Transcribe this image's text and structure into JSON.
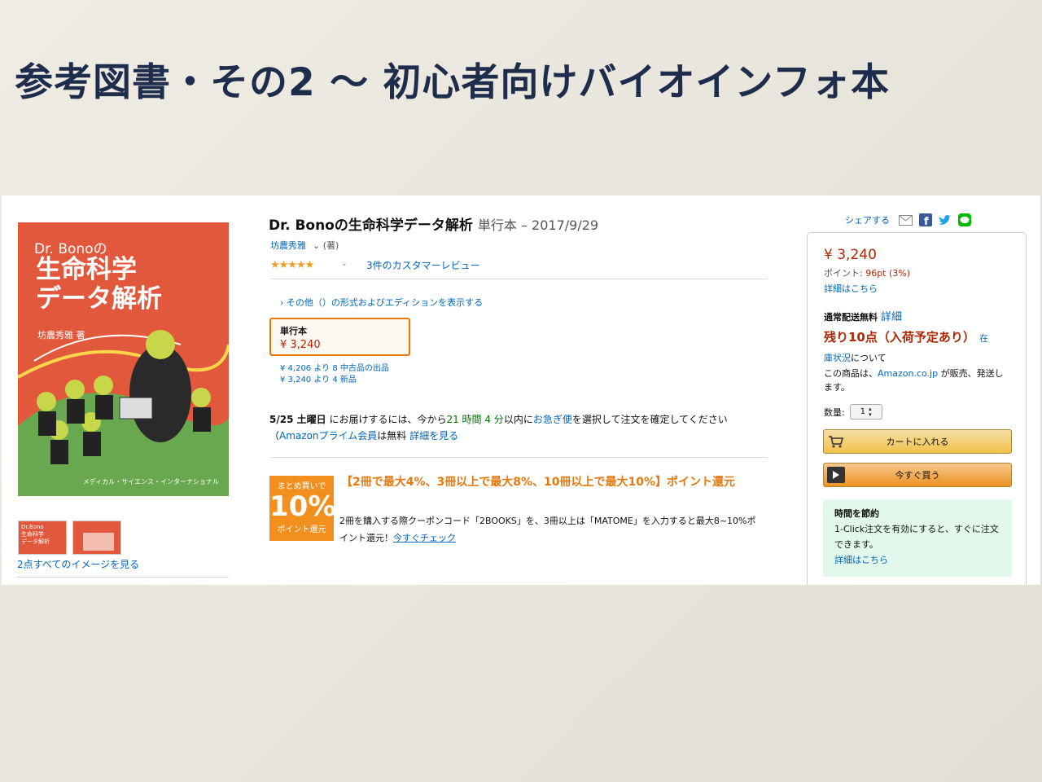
{
  "slide": {
    "title": "参考図書・その2 〜 初心者向けバイオインフォ本"
  },
  "cover": {
    "brand": "Dr. Bonoの",
    "title": "生命科学\nデータ解析",
    "author": "坊農秀雅 著",
    "publisher": "メディカル・サイエンス・インターナショナル",
    "bg_color": "#e2583c"
  },
  "thumbnails": [
    {
      "text": "Dr.Bono\n生命科学\nデータ解析"
    },
    {
      "text": ""
    }
  ],
  "images_link": "2点すべてのイメージを見る",
  "product": {
    "title": "Dr. Bonoの生命科学データ解析",
    "meta": "単行本 – 2017/9/29",
    "author": "坊農秀雅",
    "author_role": "⌄ (著)",
    "rating_stars": "★★★★★",
    "reviews": "3件のカスタマーレビュー",
    "editions": "› その他（）の形式およびエディションを表示する",
    "format_label": "単行本",
    "format_price": "¥ 3,240",
    "offers": "¥ 4,206 より 8 中古品の出品\n¥ 3,240 より 4 新品"
  },
  "delivery": {
    "date": "5/25 土曜日",
    "text_a": " にお届けするには、今から",
    "time": "21 時間 4 分",
    "text_b": "以内に",
    "express": "お急ぎ便",
    "text_c": "を選択して注文を確定してください（",
    "prime": "Amazonプライム会員",
    "text_d": "は無料 ",
    "detail_link": "詳細を見る"
  },
  "promo": {
    "badge_top": "まとめ買いで",
    "badge_num": "10%",
    "badge_bottom": "ポイント還元",
    "headline": "【2冊で最大4%、3冊以上で最大8%、10冊以上で最大10%】ポイント還元",
    "desc": "2冊を購入する際クーポンコード「2BOOKS」を、3冊以上は「MATOME」を入力すると最大8~10%ポイント還元！",
    "check_link": "今すぐチェック"
  },
  "share": {
    "label": "シェアする"
  },
  "buybox": {
    "price": "¥ 3,240",
    "points_label": "ポイント: ",
    "points_value": "96pt (3%)",
    "detail_link": "詳細はこちら",
    "shipping": "通常配送無料",
    "shipping_link": "詳細",
    "stock": "残り10点（入荷予定あり）",
    "stock_link": "在",
    "stock_link2": "庫状況",
    "stock_cont": "について",
    "seller_a": "この商品は、",
    "seller_link": "Amazon.co.jp",
    "seller_b": " が販売、発送します。",
    "qty_label": "数量:",
    "qty_value": "1",
    "cart_button": "カートに入れる",
    "buy_now_button": "今すぐ買う",
    "oneclick_title": "時間を節約",
    "oneclick_text": "1-Click注文を有効にすると、すぐに注文できます。",
    "oneclick_link": "詳細はこちら"
  },
  "colors": {
    "title_navy": "#1f2d4d",
    "link": "#0066c0",
    "price": "#b12704",
    "promo_orange": "#e47911",
    "cart_yellow": "#f0c14b",
    "buy_orange": "#ed9220"
  }
}
